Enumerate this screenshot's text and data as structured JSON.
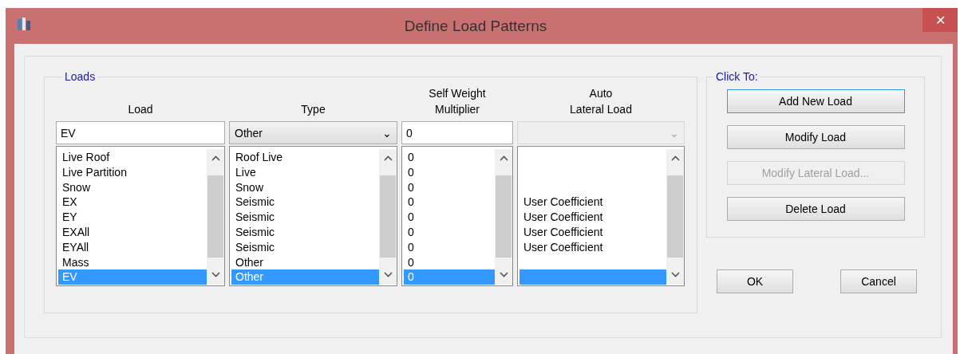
{
  "window": {
    "title": "Define Load Patterns",
    "close": "✕"
  },
  "loads_group": {
    "title": "Loads",
    "columns": [
      {
        "kind": "load",
        "label": "Load"
      },
      {
        "kind": "type",
        "label": "Type"
      },
      {
        "kind": "multiplier",
        "label": "Self Weight\nMultiplier"
      },
      {
        "kind": "lateral",
        "label": "Auto\nLateral Load"
      }
    ],
    "editor": {
      "load": {
        "value": "EV"
      },
      "type": {
        "value": "Other",
        "caret": "⌄"
      },
      "multiplier": {
        "value": "0"
      },
      "lateral": {
        "disabled": true,
        "caret": "⌄"
      }
    },
    "rows": [
      {
        "load": "Live Roof",
        "type": "Roof Live",
        "multiplier": "0",
        "selected": false
      },
      {
        "load": "Live Partition",
        "type": "Live",
        "multiplier": "0",
        "selected": false
      },
      {
        "load": "Snow",
        "type": "Snow",
        "multiplier": "0",
        "selected": false
      },
      {
        "load": "EX",
        "type": "Seismic",
        "multiplier": "0",
        "lateral": "User Coefficient",
        "selected": false
      },
      {
        "load": "EY",
        "type": "Seismic",
        "multiplier": "0",
        "lateral": "User Coefficient",
        "selected": false
      },
      {
        "load": "EXAll",
        "type": "Seismic",
        "multiplier": "0",
        "lateral": "User Coefficient",
        "selected": false
      },
      {
        "load": "EYAll",
        "type": "Seismic",
        "multiplier": "0",
        "lateral": "User Coefficient",
        "selected": false
      },
      {
        "load": "Mass",
        "type": "Other",
        "multiplier": "0",
        "selected": false
      },
      {
        "load": "EV",
        "type": "Other",
        "multiplier": "0",
        "selected": true
      }
    ]
  },
  "click_to_group": {
    "title": "Click To:",
    "buttons": [
      {
        "label": "Add New Load",
        "disabled": false,
        "focused": true
      },
      {
        "label": "Modify Load",
        "disabled": false,
        "focused": false
      },
      {
        "label": "Modify Lateral Load...",
        "disabled": true,
        "focused": false
      },
      {
        "label": "Delete Load",
        "disabled": false,
        "focused": false
      }
    ]
  },
  "dialog_buttons": [
    {
      "label": "OK"
    },
    {
      "label": "Cancel"
    }
  ]
}
